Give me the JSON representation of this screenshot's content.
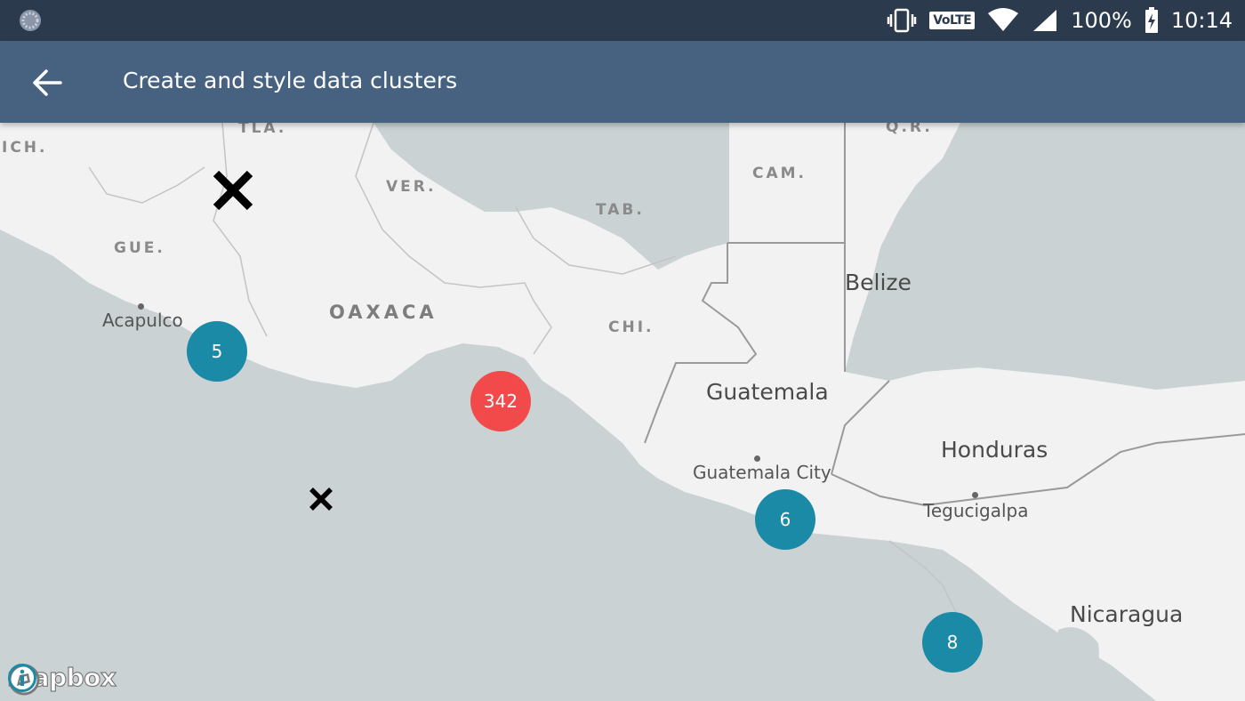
{
  "status_bar": {
    "network_badge": "VoLTE",
    "battery": "100%",
    "time": "10:14",
    "icons": [
      "settings-dots-icon",
      "vibrate-icon",
      "wifi-icon",
      "signal-icon",
      "battery-charging-icon"
    ]
  },
  "app_bar": {
    "title": "Create and style data clusters",
    "back_icon": "arrow-left-icon"
  },
  "map": {
    "state_labels": [
      "ICH.",
      "TLA.",
      "VER.",
      "TAB.",
      "CAM.",
      "Q.R.",
      "GUE.",
      "CHI."
    ],
    "region_labels": [
      "OAXACA"
    ],
    "country_labels": [
      "Belize",
      "Guatemala",
      "Honduras",
      "Nicaragua"
    ],
    "city_labels": [
      "Acapulco",
      "Guatemala City",
      "Tegucigalpa"
    ],
    "clusters": [
      {
        "count": "5",
        "color": "#1b8aa6"
      },
      {
        "count": "342",
        "color": "#f24a4a"
      },
      {
        "count": "6",
        "color": "#1b8aa6"
      },
      {
        "count": "8",
        "color": "#1b8aa6"
      }
    ],
    "markers": [
      "x-marker-icon",
      "x-marker-icon"
    ]
  },
  "attribution": {
    "logo_text": "mapbox",
    "info_icon": "info-icon"
  }
}
